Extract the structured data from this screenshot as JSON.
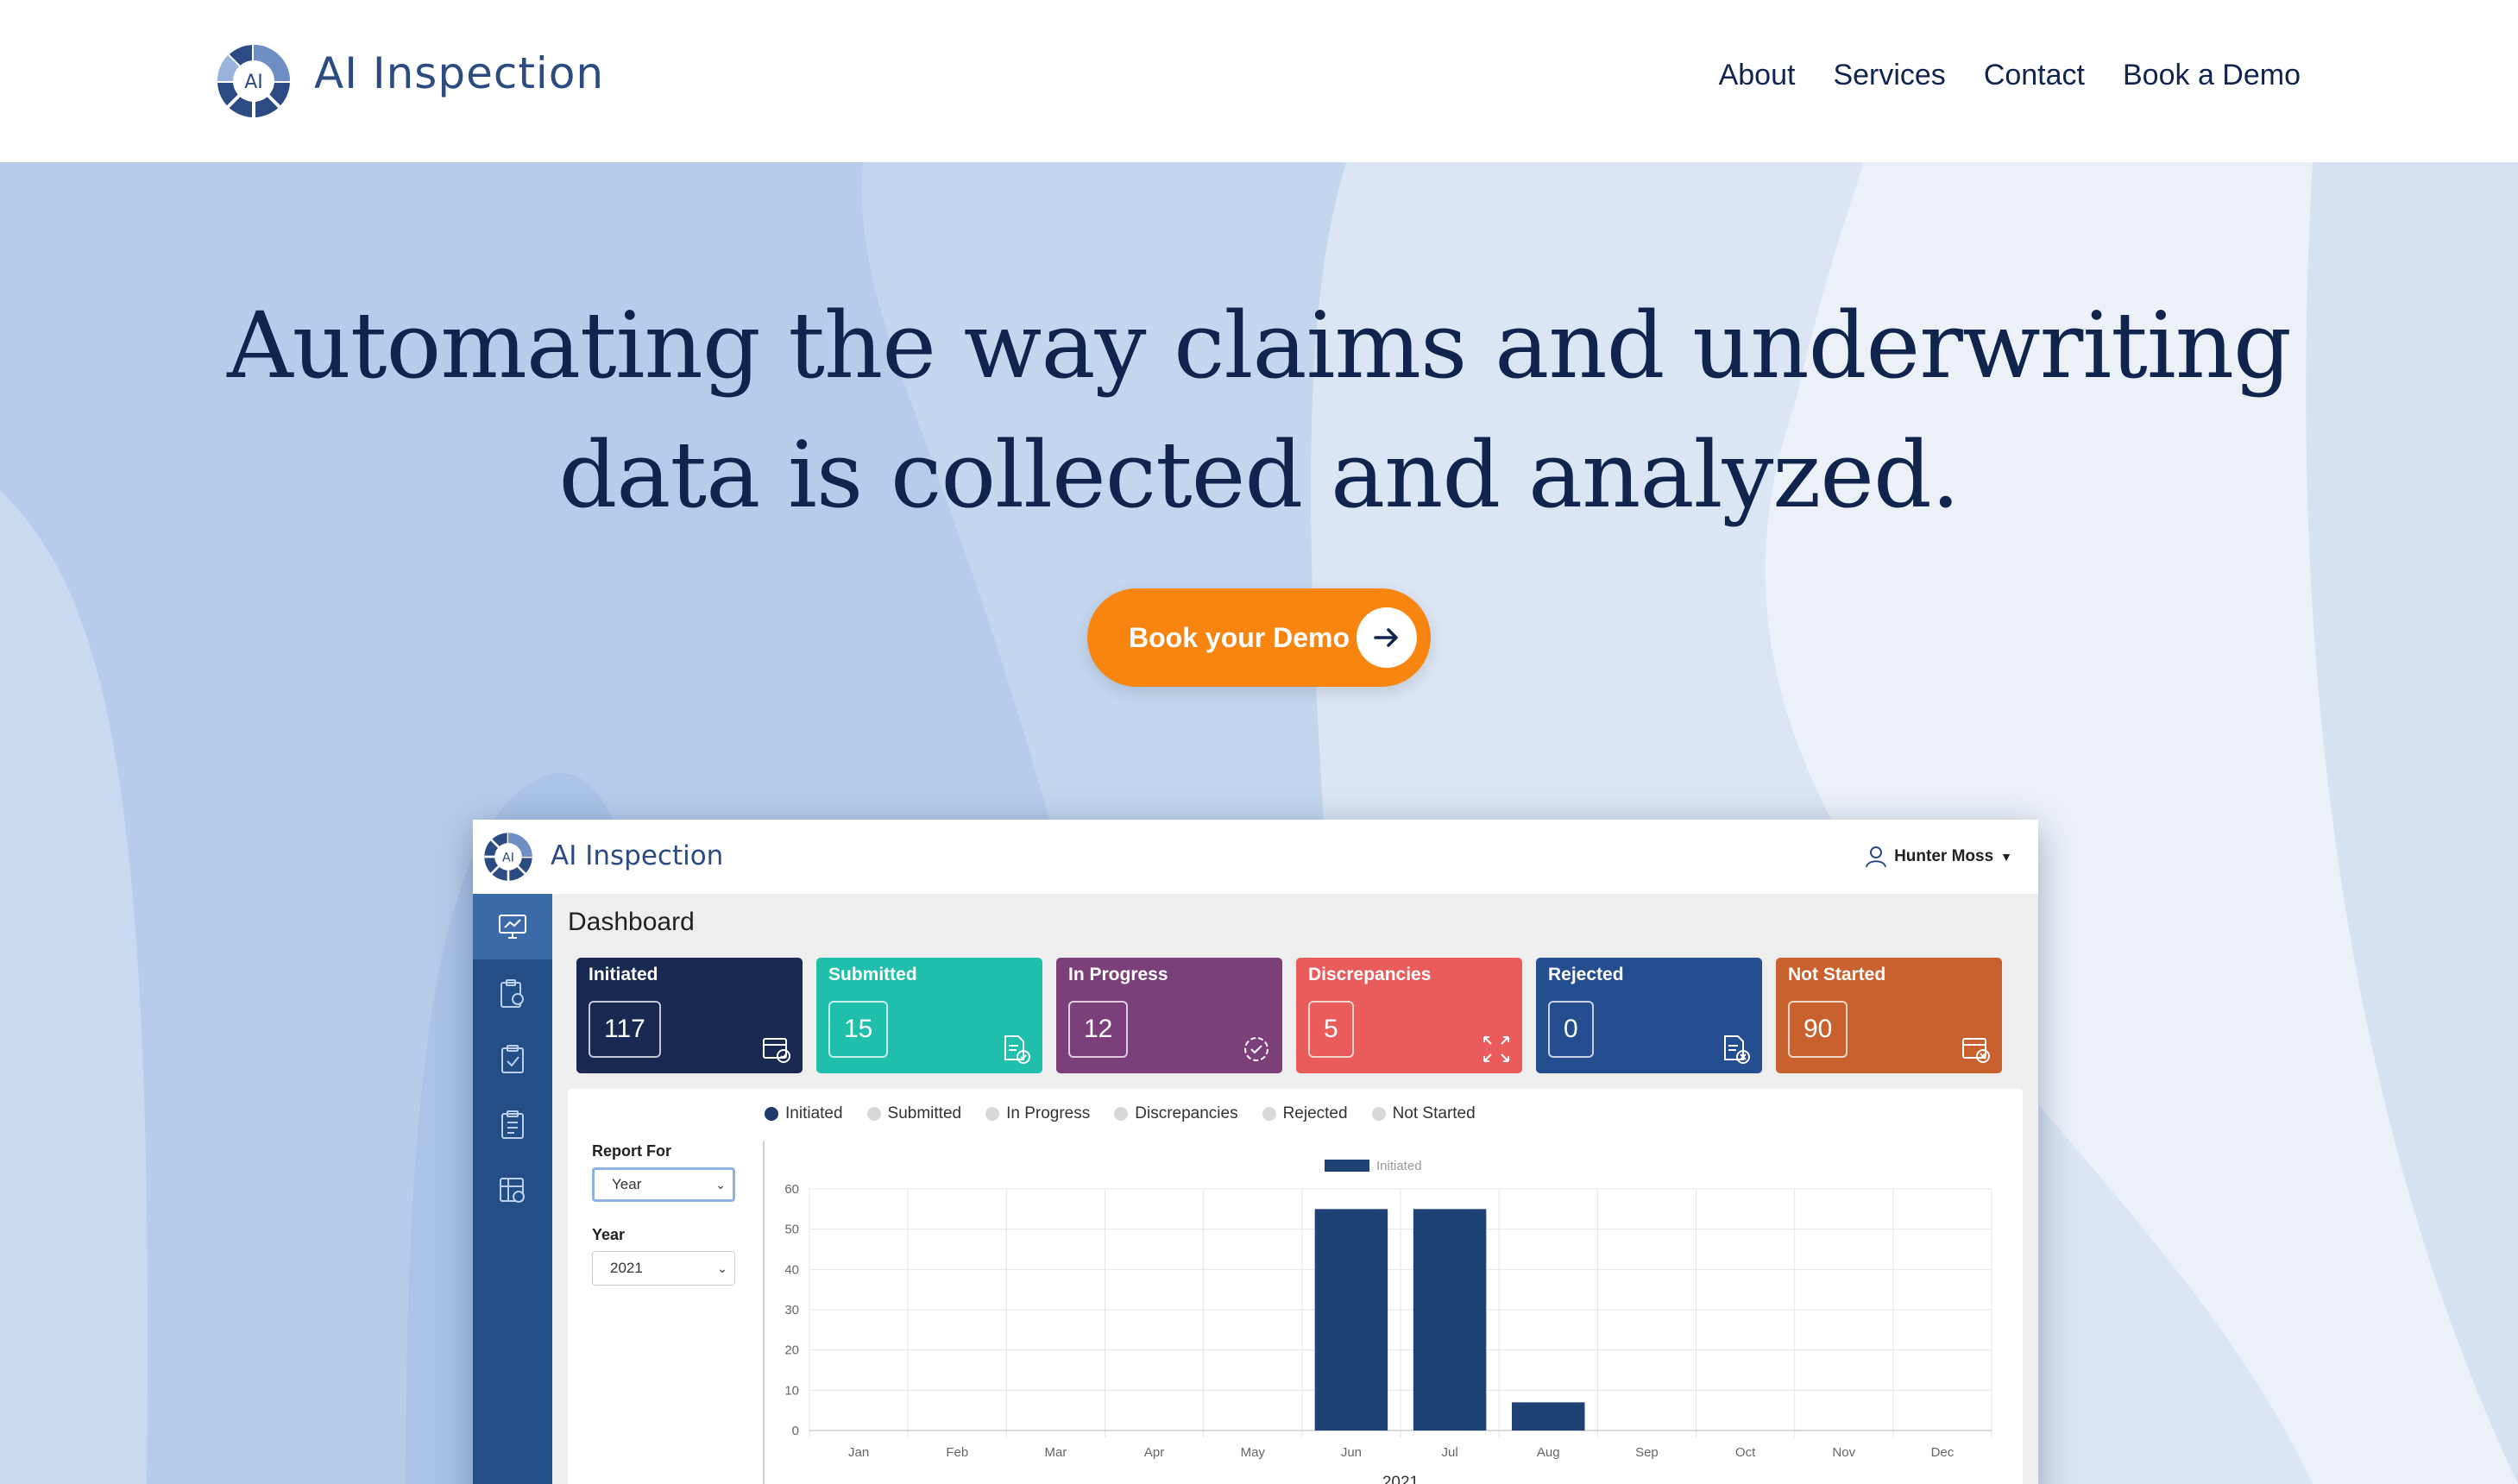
{
  "brand": {
    "name": "AI Inspection",
    "mark_text": "AI",
    "colors": {
      "navy": "#10244e",
      "blue": "#2c4b82",
      "accent": "#f7850f"
    }
  },
  "nav": {
    "items": [
      {
        "label": "About"
      },
      {
        "label": "Services"
      },
      {
        "label": "Contact"
      },
      {
        "label": "Book a Demo"
      }
    ]
  },
  "hero": {
    "headline_line1": "Automating the way claims and underwriting",
    "headline_line2": "data is collected and analyzed.",
    "cta_label": "Book your Demo",
    "cta_icon": "arrow-right-icon"
  },
  "dashboard": {
    "logo_text": "AI Inspection",
    "user_name": "Hunter Moss",
    "title": "Dashboard",
    "sidebar_icons": [
      "dashboard-icon",
      "clipboard-search-icon",
      "clipboard-check-icon",
      "clipboard-list-icon",
      "settings-grid-icon"
    ],
    "cards": [
      {
        "label": "Initiated",
        "value": "117",
        "color": "#1a2952",
        "icon": "calendar-check-icon"
      },
      {
        "label": "Submitted",
        "value": "15",
        "color": "#1fbfab",
        "icon": "document-check-icon"
      },
      {
        "label": "In Progress",
        "value": "12",
        "color": "#7b3f7a",
        "icon": "progress-check-icon"
      },
      {
        "label": "Discrepancies",
        "value": "5",
        "color": "#ea5b5b",
        "icon": "expand-arrows-icon"
      },
      {
        "label": "Rejected",
        "value": "0",
        "color": "#244e8f",
        "icon": "document-x-icon"
      },
      {
        "label": "Not Started",
        "value": "90",
        "color": "#c9612f",
        "icon": "calendar-x-icon"
      }
    ],
    "legend": [
      {
        "label": "Initiated",
        "active": true
      },
      {
        "label": "Submitted",
        "active": false
      },
      {
        "label": "In Progress",
        "active": false
      },
      {
        "label": "Discrepancies",
        "active": false
      },
      {
        "label": "Rejected",
        "active": false
      },
      {
        "label": "Not Started",
        "active": false
      }
    ],
    "filters": {
      "report_for_label": "Report For",
      "report_for_value": "Year",
      "year_label": "Year",
      "year_value": "2021"
    }
  },
  "chart_data": {
    "type": "bar",
    "categories": [
      "Jan",
      "Feb",
      "Mar",
      "Apr",
      "May",
      "Jun",
      "Jul",
      "Aug",
      "Sep",
      "Oct",
      "Nov",
      "Dec"
    ],
    "series": [
      {
        "name": "Initiated",
        "values": [
          0,
          0,
          0,
          0,
          0,
          55,
          55,
          7,
          0,
          0,
          0,
          0
        ],
        "color": "#1f4275"
      }
    ],
    "xlabel": "2021",
    "ylabel": "",
    "ylim": [
      0,
      60
    ],
    "yticks": [
      0,
      10,
      20,
      30,
      40,
      50,
      60
    ],
    "grid": true,
    "legend_position": "top-center"
  }
}
